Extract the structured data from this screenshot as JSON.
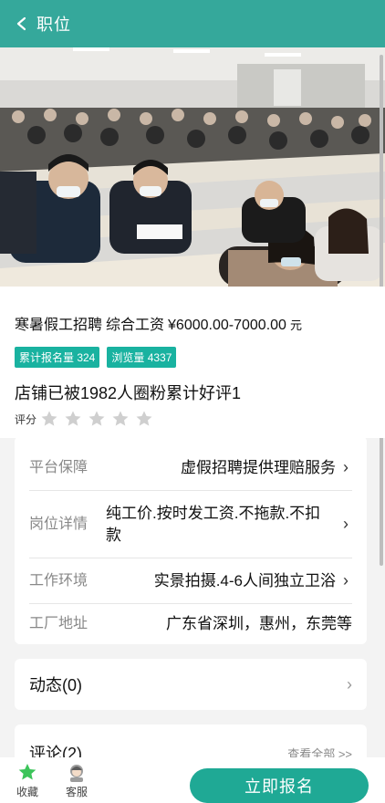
{
  "header": {
    "title": "职位"
  },
  "job": {
    "name": "寒暑假工招聘",
    "salary_label": "综合工资",
    "salary": "¥6000.00-7000.00",
    "salary_unit": "元",
    "badge_signups": "累计报名量 324",
    "badge_views": "浏览量 4337",
    "store": "店铺已被1982人圈粉累计好评1",
    "rating_label": "评分",
    "rating_value": 0,
    "rating_max": 5
  },
  "details": {
    "guarantee_key": "平台保障",
    "guarantee_val": "虚假招聘提供理赔服务",
    "job_detail_key": "岗位详情",
    "job_detail_val": "纯工价.按时发工资.不拖款.不扣款",
    "env_key": "工作环境",
    "env_val": "实景拍摄.4-6人间独立卫浴",
    "addr_key": "工厂地址",
    "addr_val": "广东省深圳，惠州，东莞等"
  },
  "dynamics": {
    "label": "动态(0)"
  },
  "comments": {
    "label": "评论(2)",
    "view_all": "查看全部 >>"
  },
  "bottom": {
    "fav_label": "收藏",
    "service_label": "客服",
    "signup_label": "立即报名"
  },
  "colors": {
    "brand": "#35a89b",
    "badge": "#19b2a0",
    "button": "#1fa995"
  }
}
